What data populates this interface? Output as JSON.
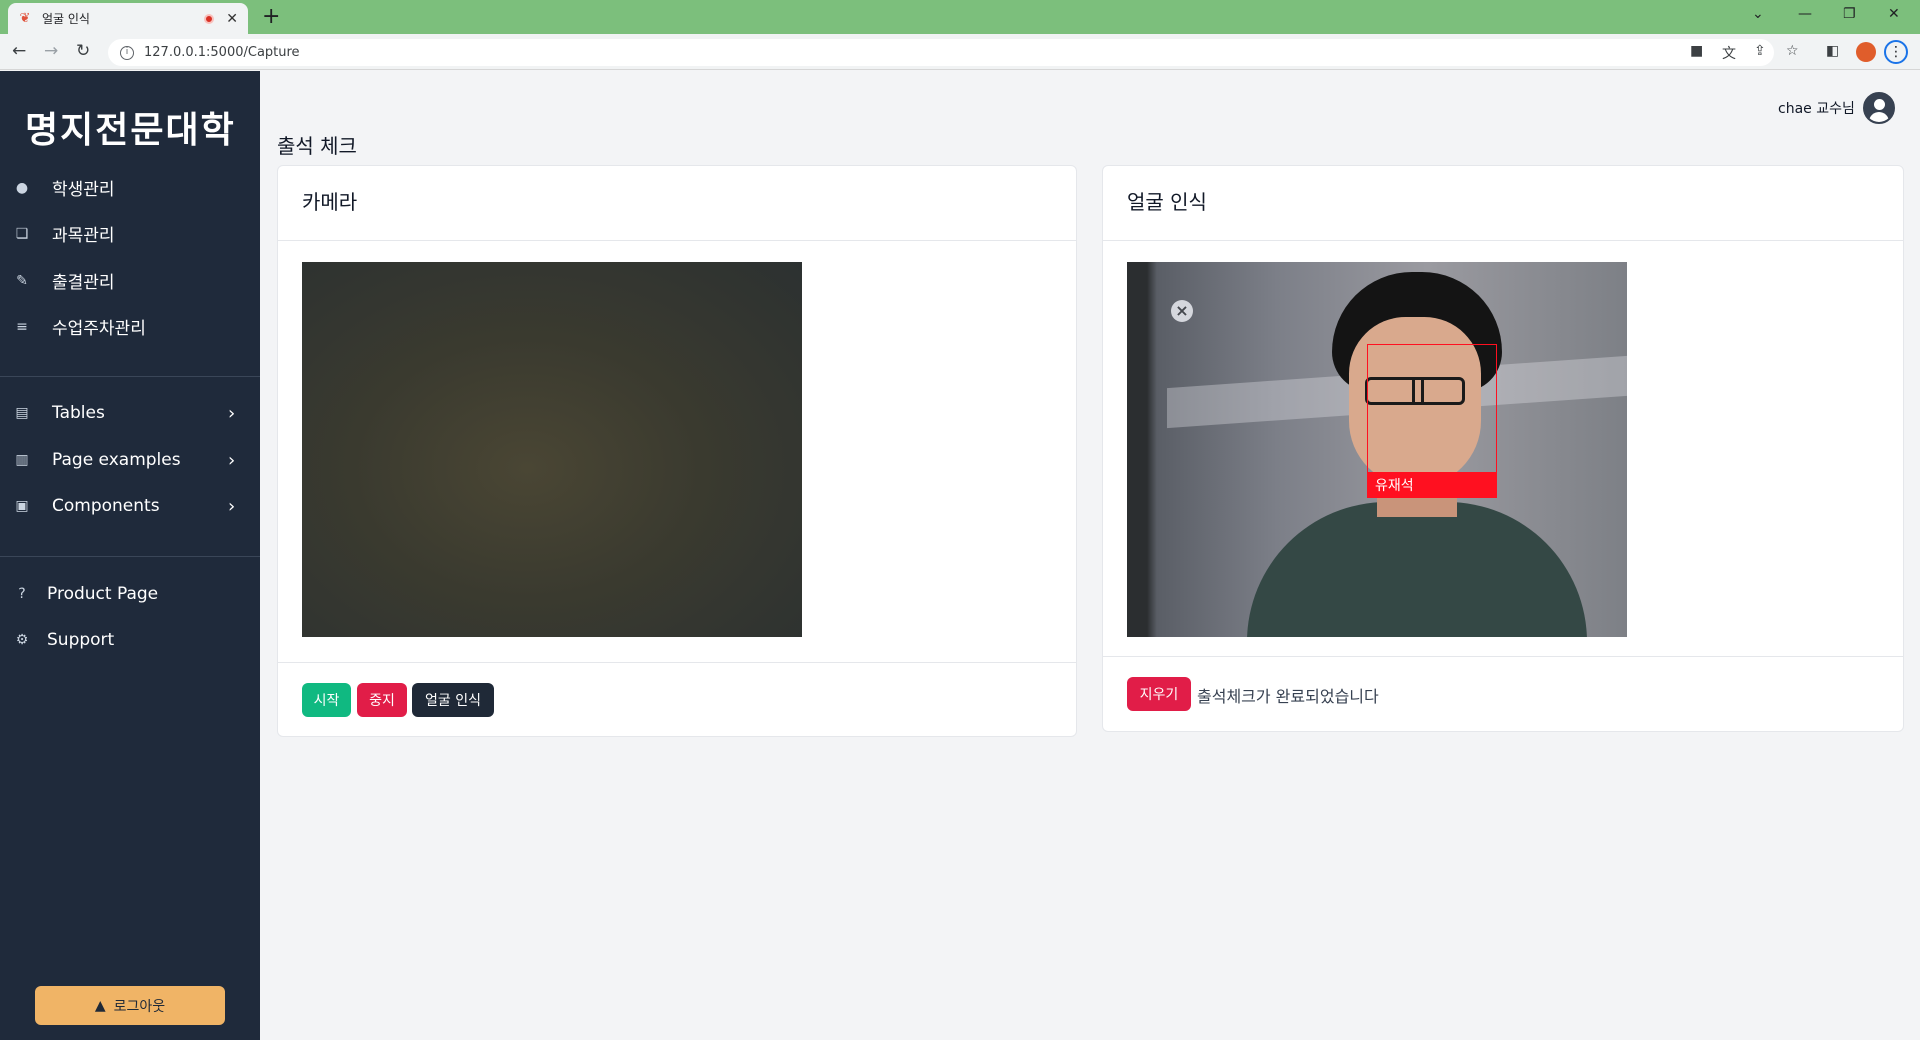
{
  "browser": {
    "tab_title": "얼굴 인식",
    "url": "127.0.0.1:5000/Capture"
  },
  "sidebar": {
    "brand": "명지전문대학",
    "main_items": [
      {
        "label": "학생관리",
        "icon": "user-icon"
      },
      {
        "label": "과목관리",
        "icon": "copy-icon"
      },
      {
        "label": "출결관리",
        "icon": "edit-icon"
      },
      {
        "label": "수업주차관리",
        "icon": "list-icon"
      }
    ],
    "group_items": [
      {
        "label": "Tables",
        "icon": "table-icon"
      },
      {
        "label": "Page examples",
        "icon": "page-icon"
      },
      {
        "label": "Components",
        "icon": "archive-icon"
      }
    ],
    "extra_items": [
      {
        "label": "Product Page",
        "icon": "question-icon"
      },
      {
        "label": "Support",
        "icon": "gear-icon"
      }
    ],
    "logout_label": "로그아웃"
  },
  "header": {
    "user_name": "chae 교수님"
  },
  "page": {
    "title": "출석 체크"
  },
  "camera_card": {
    "title": "카메라",
    "buttons": {
      "start": "시작",
      "stop": "중지",
      "recognize": "얼굴 인식"
    }
  },
  "face_card": {
    "title": "얼굴 인식",
    "detected_name": "유재석",
    "clear_label": "지우기",
    "status": "출석체크가 완료되었습니다"
  },
  "colors": {
    "sidebar_bg": "#1f2a3b",
    "start": "#10b981",
    "stop": "#e11d48",
    "recognize": "#1f2937",
    "logout": "#f0b466",
    "bbox": "#ff1020"
  }
}
